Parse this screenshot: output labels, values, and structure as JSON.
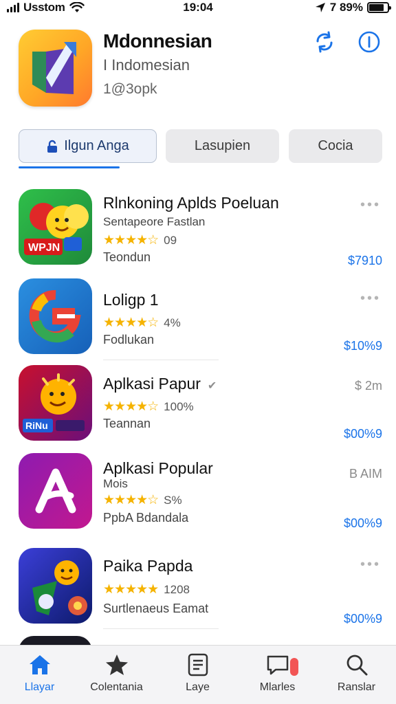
{
  "status": {
    "carrier": "Usstom",
    "time": "19:04",
    "battery_text": "7 89%"
  },
  "header": {
    "title": "Mdonnesian",
    "subtitle": "I Indomesian",
    "meta": "1@3opk"
  },
  "tabs": [
    {
      "label": "Ilgun Anga",
      "icon": "lock-icon",
      "active": true
    },
    {
      "label": "Lasupien",
      "active": false
    },
    {
      "label": "Cocia",
      "active": false
    }
  ],
  "items": [
    {
      "title": "Rlnkoning Aplds Poeluan",
      "subtitle": "Sentapeore Fastlan",
      "rating": "09",
      "category": "Teondun",
      "price": "$7910",
      "right_top": "•••"
    },
    {
      "title": "Loligp 1",
      "subtitle": "",
      "rating": "4%",
      "category": "Fodlukan",
      "price": "$10%9",
      "right_top": "•••"
    },
    {
      "title": "Aplkasi Papur",
      "subtitle": "",
      "rating": "100%",
      "category": "Teannan",
      "price": "$00%9",
      "right_top": "$ 2m"
    },
    {
      "title": "Aplkasi Popular",
      "subtitle": "Mois",
      "rating": "S%",
      "category": "PpbA Bdandala",
      "price": "$00%9",
      "right_top": "B AIM"
    },
    {
      "title": "Paika Papda",
      "subtitle": "",
      "rating": "1208",
      "category": "Surtlenaeus Eamat",
      "price": "$00%9",
      "right_top": "•••"
    }
  ],
  "tabbar": [
    {
      "label": "Llayar",
      "icon": "home-icon",
      "active": true
    },
    {
      "label": "Colentania",
      "icon": "star-icon",
      "active": false
    },
    {
      "label": "Laye",
      "icon": "list-icon",
      "active": false
    },
    {
      "label": "Mlarles",
      "icon": "chat-icon",
      "active": false
    },
    {
      "label": "Ranslar",
      "icon": "search-icon",
      "active": false
    }
  ],
  "colors": {
    "accent": "#1a73e8",
    "star": "#f5b300",
    "badge": "#f25555"
  }
}
